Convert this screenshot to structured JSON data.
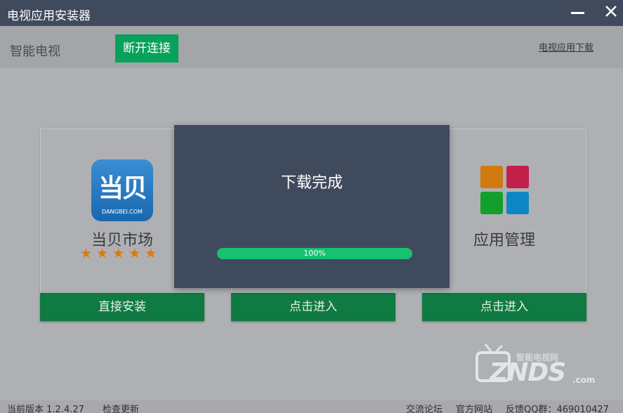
{
  "window": {
    "title": "电视应用安装器"
  },
  "toolbar": {
    "device_label": "智能电视",
    "disconnect_label": "断开连接",
    "download_link": "电视应用下载"
  },
  "cards": [
    {
      "name": "当贝市场",
      "logo_text": "当贝",
      "logo_subtext": "DANGBEI.COM",
      "rating": 5,
      "stars": "★★★★★",
      "button": "直接安装"
    },
    {
      "name": "",
      "button": "点击进入"
    },
    {
      "name": "应用管理",
      "button": "点击进入",
      "tiles": [
        "#d07a0f",
        "#c21f4a",
        "#12a02a",
        "#0f86c4"
      ]
    }
  ],
  "modal": {
    "title": "下载完成",
    "progress_percent": 100,
    "progress_text": "100%"
  },
  "watermark": {
    "cn": "智能电视网",
    "en": "ZNDS",
    "suffix": ".com"
  },
  "status": {
    "version": "当前版本 1.2.4.27",
    "check_update": "检查更新",
    "forum": "交流论坛",
    "website": "官方网站",
    "qq_group": "反馈QQ群：469010427"
  },
  "colors": {
    "titlebar": "#404a5d",
    "accent_green": "#07a25a",
    "button_green": "#0f7a41",
    "progress": "#16c170"
  }
}
